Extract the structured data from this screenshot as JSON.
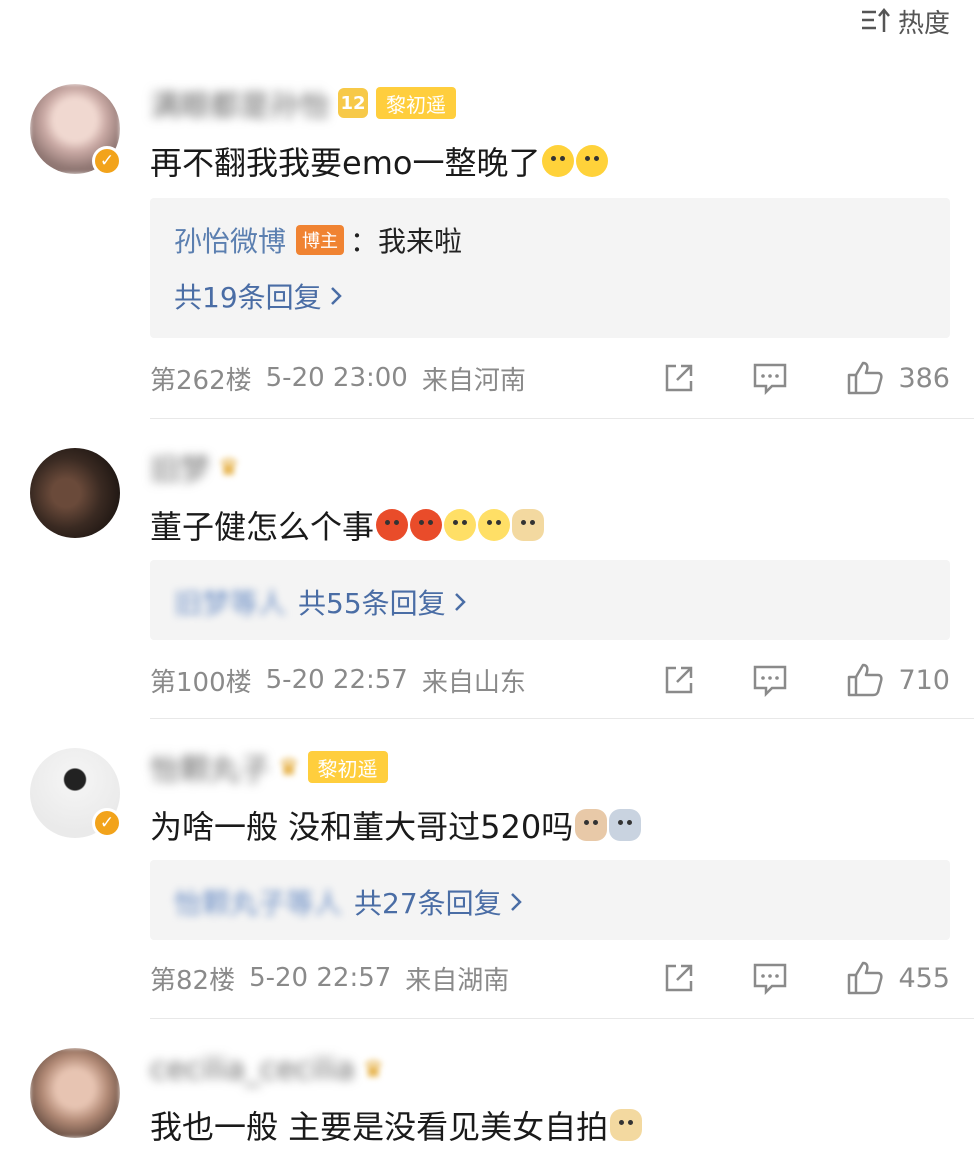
{
  "sort": {
    "label": "热度",
    "icon": "sort-icon"
  },
  "comments": [
    {
      "level": "12",
      "fan_badge": "黎初遥",
      "text": "再不翻我我要emo一整晚了",
      "emojis": [
        "cry",
        "cry"
      ],
      "reply": {
        "author": "孙怡微博",
        "host_badge": "博主",
        "text": "：我来啦",
        "count_label": "共19条回复"
      },
      "floor": "第262楼",
      "time": "5-20 23:00",
      "location": "来自河南",
      "likes": "386"
    },
    {
      "text": "董子健怎么个事",
      "emojis": [
        "angry",
        "angry",
        "think",
        "think",
        "doge"
      ],
      "reply": {
        "count_label": "共55条回复"
      },
      "floor": "第100楼",
      "time": "5-20 22:57",
      "location": "来自山东",
      "likes": "710"
    },
    {
      "fan_badge": "黎初遥",
      "text": "为啥一般 没和董大哥过520吗",
      "emojis": [
        "cat",
        "husky"
      ],
      "reply": {
        "count_label": "共27条回复"
      },
      "floor": "第82楼",
      "time": "5-20 22:57",
      "location": "来自湖南",
      "likes": "455"
    },
    {
      "text": "我也一般 主要是没看见美女自拍",
      "emojis": [
        "doge"
      ]
    }
  ],
  "colors": {
    "link": "#4a6da5",
    "meta": "#8a8a8a",
    "badge": "#ffce3d",
    "host": "#f08332"
  }
}
